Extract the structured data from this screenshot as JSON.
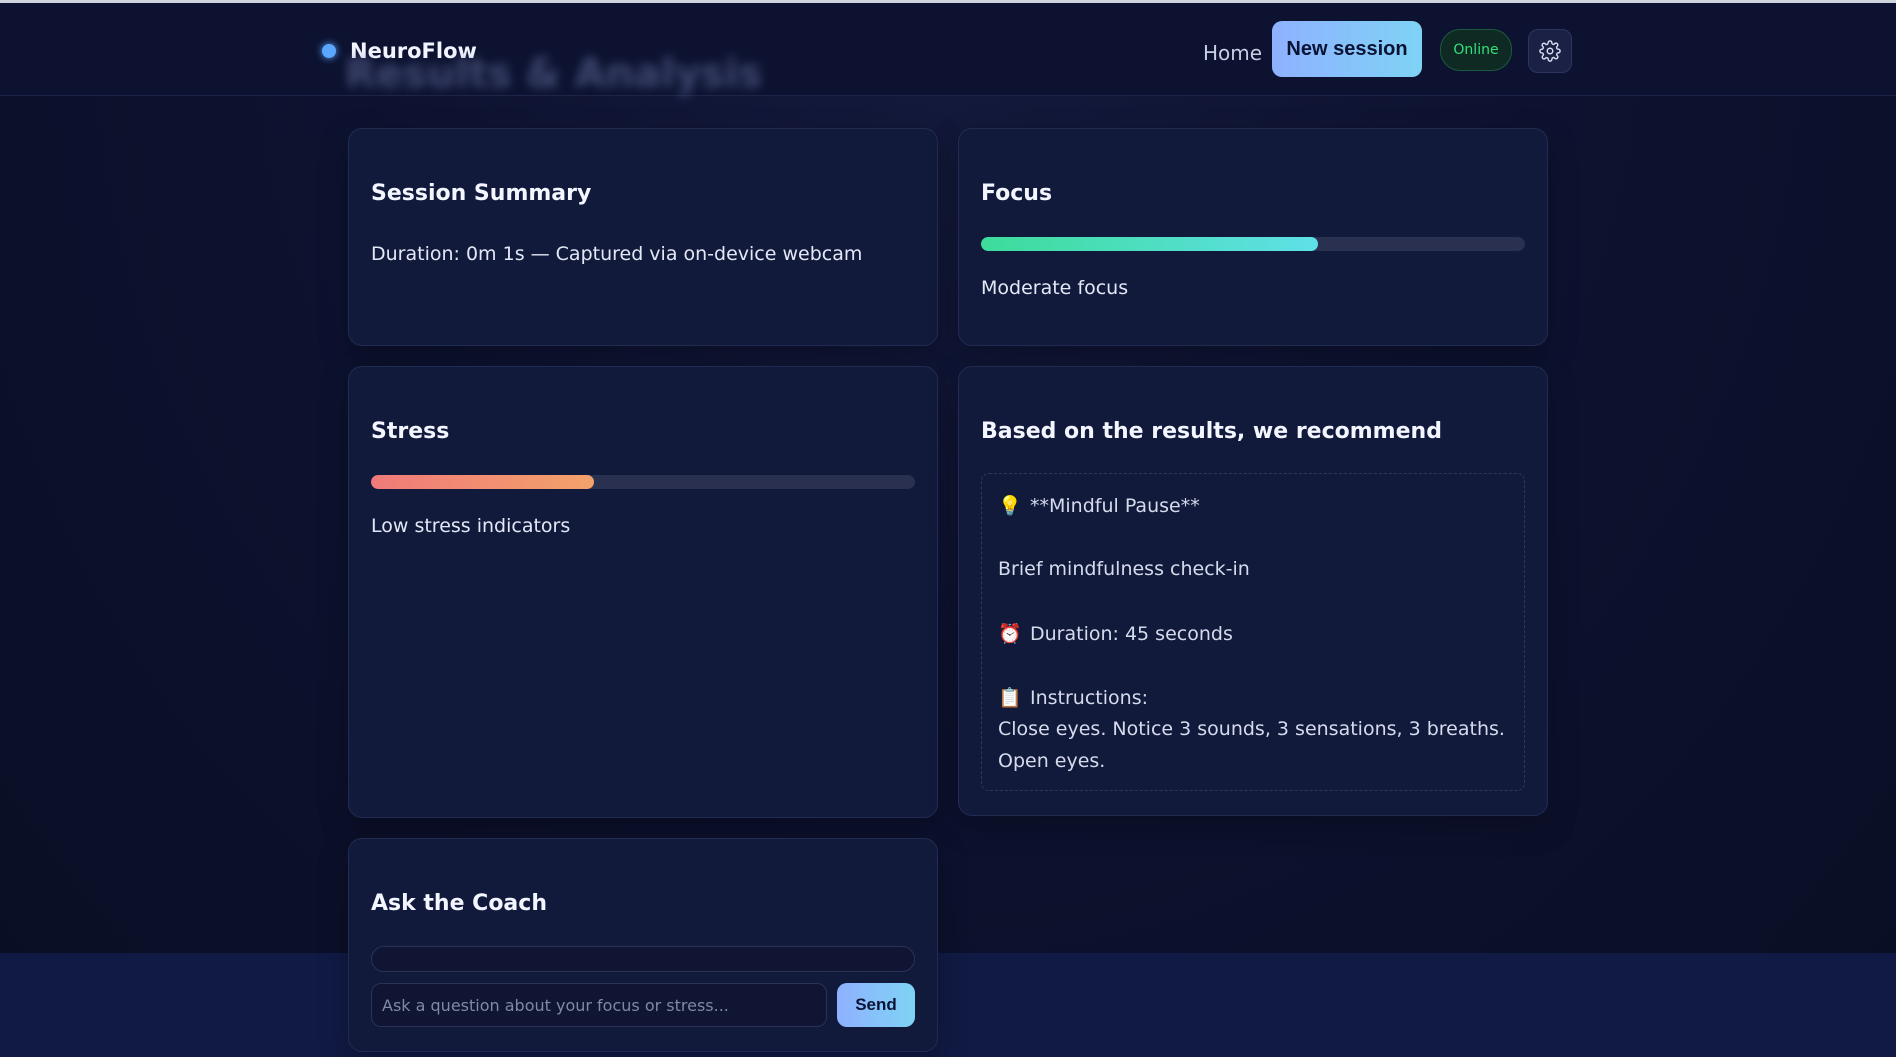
{
  "header": {
    "brand": "NeuroFlow",
    "ghost_title": "Results & Analysis",
    "nav_home": "Home",
    "new_session": "New session",
    "status": "Online"
  },
  "summary": {
    "title": "Session Summary",
    "text": "Duration: 0m 1s — Captured via on-device webcam"
  },
  "focus": {
    "title": "Focus",
    "level": 0.62,
    "text": "Moderate focus"
  },
  "stress": {
    "title": "Stress",
    "level": 0.41,
    "text": "Low stress indicators"
  },
  "recommend": {
    "title": "Based on the results, we recommend",
    "name": "**Mindful Pause**",
    "description": "Brief mindfulness check-in",
    "duration": "Duration: 45 seconds",
    "instructions_label": "Instructions:",
    "instructions_line1": "Close eyes. Notice 3 sounds, 3 sensations, 3 breaths.",
    "instructions_line2": "Open eyes."
  },
  "coach": {
    "title": "Ask the Coach",
    "placeholder": "Ask a question about your focus or stress...",
    "send": "Send"
  },
  "colors": {
    "accent": "#5aa7ff",
    "focus_bar_start": "#3ddc9a",
    "focus_bar_end": "#5fe0e8",
    "stress_bar_start": "#f07a7a",
    "stress_bar_end": "#f3a26a",
    "online": "#35e07a"
  }
}
